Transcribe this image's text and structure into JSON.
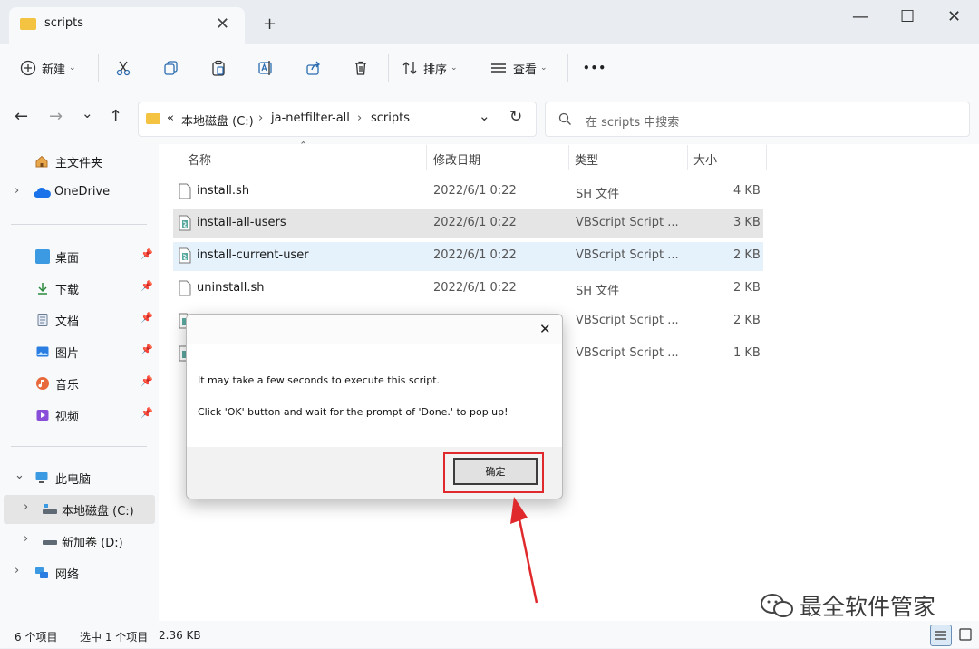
{
  "window": {
    "tab_title": "scripts",
    "tab_close": "✕",
    "new_tab": "+",
    "minimize": "—",
    "maximize": "☐",
    "close": "✕"
  },
  "toolbar": {
    "new_label": "新建",
    "sort_label": "排序",
    "view_label": "查看",
    "more_label": "•••"
  },
  "nav": {
    "back": "←",
    "forward": "→",
    "recent": "⌄",
    "up": "↑",
    "breadcrumb_prefix": "«",
    "breadcrumb": [
      "本地磁盘 (C:)",
      "ja-netfilter-all",
      "scripts"
    ],
    "breadcrumb_sep": "›",
    "refresh": "↻",
    "search_placeholder": "在 scripts 中搜索"
  },
  "sidebar": {
    "home": "主文件夹",
    "onedrive": "OneDrive",
    "quick": [
      {
        "label": "桌面",
        "icon": "desktop-icon"
      },
      {
        "label": "下载",
        "icon": "download-icon"
      },
      {
        "label": "文档",
        "icon": "document-icon"
      },
      {
        "label": "图片",
        "icon": "pictures-icon"
      },
      {
        "label": "音乐",
        "icon": "music-icon"
      },
      {
        "label": "视频",
        "icon": "video-icon"
      }
    ],
    "this_pc": "此电脑",
    "drive_c": "本地磁盘 (C:)",
    "drive_d": "新加卷 (D:)",
    "network": "网络"
  },
  "columns": {
    "name": "名称",
    "date": "修改日期",
    "type": "类型",
    "size": "大小"
  },
  "files": [
    {
      "name": "install.sh",
      "date": "2022/6/1 0:22",
      "type": "SH 文件",
      "size": "4 KB",
      "kind": "sh"
    },
    {
      "name": "install-all-users",
      "date": "2022/6/1 0:22",
      "type": "VBScript Script ...",
      "size": "3 KB",
      "kind": "vbs"
    },
    {
      "name": "install-current-user",
      "date": "2022/6/1 0:22",
      "type": "VBScript Script ...",
      "size": "2 KB",
      "kind": "vbs"
    },
    {
      "name": "uninstall.sh",
      "date": "2022/6/1 0:22",
      "type": "SH 文件",
      "size": "2 KB",
      "kind": "sh"
    },
    {
      "name": "",
      "date": "",
      "type": "VBScript Script ...",
      "size": "2 KB",
      "kind": "vbs"
    },
    {
      "name": "",
      "date": "",
      "type": "VBScript Script ...",
      "size": "1 KB",
      "kind": "vbs"
    }
  ],
  "status": {
    "count": "6 个项目",
    "selected": "选中 1 个项目",
    "size": "2.36 KB"
  },
  "dialog": {
    "close": "✕",
    "line1": "It may take a few seconds to execute this script.",
    "line2": "Click 'OK' button and wait for the prompt of 'Done.' to pop up!",
    "ok_label": "确定"
  },
  "watermark": "最全软件管家",
  "colors": {
    "highlight": "#e0292c",
    "selected_row": "#cce8ff",
    "hover_row": "#e5e5e5"
  }
}
